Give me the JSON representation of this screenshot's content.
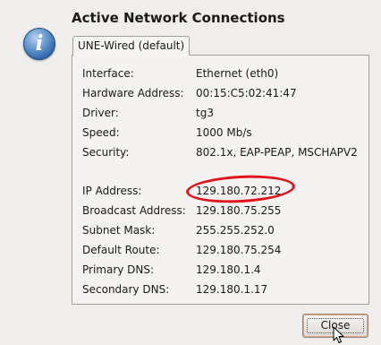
{
  "dialog": {
    "title": "Active Network Connections",
    "icon": "info-icon",
    "tab_label": "UNE-Wired (default)",
    "close_label": "Close"
  },
  "details": {
    "interface": {
      "label": "Interface:",
      "value": "Ethernet (eth0)"
    },
    "hardware": {
      "label": "Hardware Address:",
      "value": "00:15:C5:02:41:47"
    },
    "driver": {
      "label": "Driver:",
      "value": "tg3"
    },
    "speed": {
      "label": "Speed:",
      "value": "1000 Mb/s"
    },
    "security": {
      "label": "Security:",
      "value": "802.1x, EAP-PEAP, MSCHAPV2"
    },
    "ip": {
      "label": "IP Address:",
      "value": "129.180.72.212"
    },
    "broadcast": {
      "label": "Broadcast Address:",
      "value": "129.180.75.255"
    },
    "subnet": {
      "label": "Subnet Mask:",
      "value": "255.255.252.0"
    },
    "route": {
      "label": "Default Route:",
      "value": "129.180.75.254"
    },
    "dns1": {
      "label": "Primary DNS:",
      "value": "129.180.1.4"
    },
    "dns2": {
      "label": "Secondary DNS:",
      "value": "129.180.1.17"
    }
  },
  "colors": {
    "highlight": "#e0121b"
  }
}
